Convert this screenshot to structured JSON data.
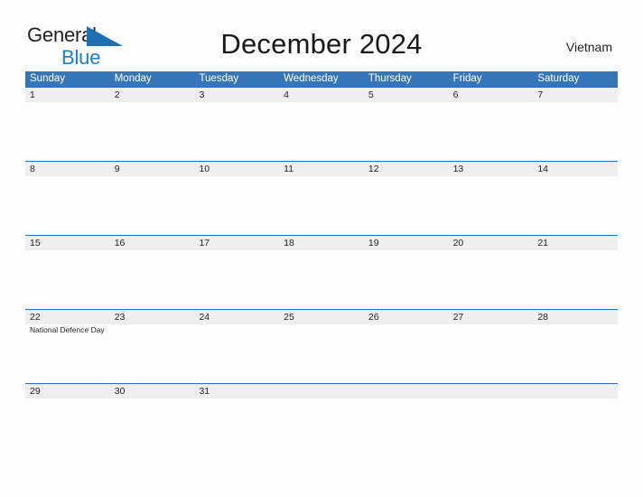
{
  "brand": {
    "name_part1": "General",
    "name_part2": "Blue",
    "flag_icon": "blue-triangle-flag-icon",
    "color_dark": "#231f20",
    "color_blue": "#1f7fc4"
  },
  "header": {
    "title": "December 2024",
    "region": "Vietnam"
  },
  "theme": {
    "header_blue": "#3576b8",
    "divider_blue": "#2a6db3",
    "date_band_gray": "#efefef",
    "page_background": "#fdfdfd",
    "text_dark": "#231f20"
  },
  "calendar": {
    "month": "December",
    "year": "2024",
    "weekday_headers": [
      "Sunday",
      "Monday",
      "Tuesday",
      "Wednesday",
      "Thursday",
      "Friday",
      "Saturday"
    ],
    "weeks": [
      {
        "days": [
          {
            "number": "1",
            "events": []
          },
          {
            "number": "2",
            "events": []
          },
          {
            "number": "3",
            "events": []
          },
          {
            "number": "4",
            "events": []
          },
          {
            "number": "5",
            "events": []
          },
          {
            "number": "6",
            "events": []
          },
          {
            "number": "7",
            "events": []
          }
        ]
      },
      {
        "days": [
          {
            "number": "8",
            "events": []
          },
          {
            "number": "9",
            "events": []
          },
          {
            "number": "10",
            "events": []
          },
          {
            "number": "11",
            "events": []
          },
          {
            "number": "12",
            "events": []
          },
          {
            "number": "13",
            "events": []
          },
          {
            "number": "14",
            "events": []
          }
        ]
      },
      {
        "days": [
          {
            "number": "15",
            "events": []
          },
          {
            "number": "16",
            "events": []
          },
          {
            "number": "17",
            "events": []
          },
          {
            "number": "18",
            "events": []
          },
          {
            "number": "19",
            "events": []
          },
          {
            "number": "20",
            "events": []
          },
          {
            "number": "21",
            "events": []
          }
        ]
      },
      {
        "days": [
          {
            "number": "22",
            "events": [
              "National Defence Day"
            ]
          },
          {
            "number": "23",
            "events": []
          },
          {
            "number": "24",
            "events": []
          },
          {
            "number": "25",
            "events": []
          },
          {
            "number": "26",
            "events": []
          },
          {
            "number": "27",
            "events": []
          },
          {
            "number": "28",
            "events": []
          }
        ]
      },
      {
        "days": [
          {
            "number": "29",
            "events": []
          },
          {
            "number": "30",
            "events": []
          },
          {
            "number": "31",
            "events": []
          },
          {
            "number": "",
            "events": []
          },
          {
            "number": "",
            "events": []
          },
          {
            "number": "",
            "events": []
          },
          {
            "number": "",
            "events": []
          }
        ]
      }
    ]
  }
}
